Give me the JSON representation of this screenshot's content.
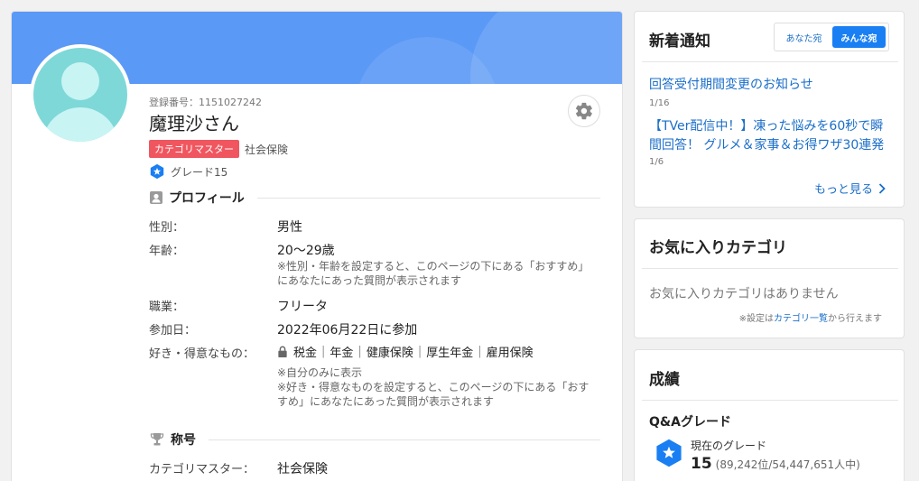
{
  "profile": {
    "registration": "登録番号：1151027242",
    "name": "魔理沙さん",
    "category_badge": "カテゴリマスター",
    "category_name": "社会保険",
    "grade": "グレード15"
  },
  "profile_section": {
    "title": "プロフィール",
    "gender_label": "性別：",
    "gender_value": "男性",
    "age_label": "年齢：",
    "age_value": "20〜29歳",
    "age_note_line1": "※性別・年齢を設定すると、このページの下にある「おすすめ」",
    "age_note_line2": "にあなたにあった質問が表示されます",
    "job_label": "職業：",
    "job_value": "フリータ",
    "join_label": "参加日：",
    "join_value": "2022年06月22日に参加",
    "likes_label": "好き・得意なもの：",
    "likes": [
      "税金",
      "年金",
      "健康保険",
      "厚生年金",
      "雇用保険"
    ],
    "likes_note_line1": "※自分のみに表示",
    "likes_note_line2": "※好き・得意なものを設定すると、このページの下にある「おす",
    "likes_note_line3": "すめ」にあなたにあった質問が表示されます"
  },
  "title_section": {
    "title": "称号",
    "master_label": "カテゴリマスター：",
    "master_value": "社会保険"
  },
  "notifications": {
    "title": "新着通知",
    "tab_you": "あなた宛",
    "tab_all": "みんな宛",
    "items": [
      {
        "title": "回答受付期間変更のお知らせ",
        "date": "1/16"
      },
      {
        "title": "【TVer配信中！】凍った悩みを60秒で瞬間回答！ グルメ＆家事＆お得ワザ30連発",
        "date": "1/6"
      }
    ],
    "more": "もっと見る"
  },
  "favorites": {
    "title": "お気に入りカテゴリ",
    "empty": "お気に入りカテゴリはありません",
    "hint_prefix": "※設定は",
    "hint_link": "カテゴリ一覧",
    "hint_suffix": "から行えます"
  },
  "results": {
    "title": "成績",
    "qa_title": "Q&Aグレード",
    "current_label": "現在のグレード",
    "current_value": "15",
    "rank": "(89,242位/54,447,651人中)"
  },
  "colors": {
    "banner": "#5b99f6",
    "accent_link": "#1a6ec9",
    "category_badge": "#f0565f",
    "grade_icon": "#1a7ff3"
  }
}
